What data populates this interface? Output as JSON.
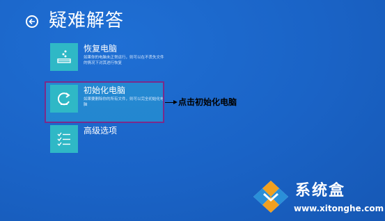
{
  "header": {
    "title": "疑难解答"
  },
  "options": [
    {
      "title": "恢复电脑",
      "desc": "如果你的电脑未正常运行，则可以在不丢失文件的情况下对其进行恢复"
    },
    {
      "title": "初始化电脑",
      "desc": "如果要删除你的所有文件，则可以完全初始化电脑"
    },
    {
      "title": "高级选项",
      "desc": ""
    }
  ],
  "annotation": {
    "text": "点击初始化电脑"
  },
  "watermark": {
    "name": "系统盒",
    "url": "www.xitonghe.com"
  },
  "colors": {
    "background": "#1a63c6",
    "tile": "#2fb8c6",
    "highlight_border": "#7b2a8a",
    "annotation": "#000000"
  },
  "icons": {
    "back": "back-arrow-icon",
    "restore": "restore-icon",
    "reset": "refresh-icon",
    "advanced": "checklist-icon",
    "logo": "xitonghe-logo-icon"
  }
}
